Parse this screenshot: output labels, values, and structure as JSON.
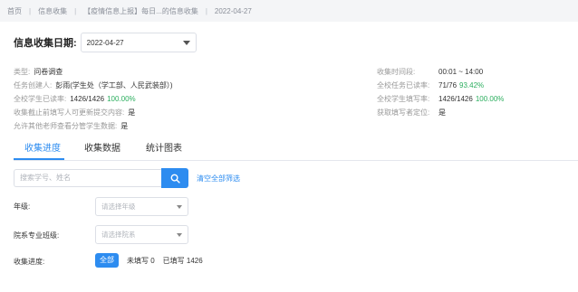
{
  "breadcrumb": {
    "items": [
      "首页",
      "信息收集",
      "【疫情信息上报】每日...的信息收集",
      "2022-04-27"
    ]
  },
  "date_picker": {
    "label": "信息收集日期:",
    "value": "2022-04-27"
  },
  "info_left": [
    {
      "key": "类型:",
      "value": "问卷调查"
    },
    {
      "key": "任务创建人:",
      "value": "彭雨(学生处（学工部、人民武装部）)"
    },
    {
      "key": "全校学生已读率:",
      "value": "1426/1426",
      "pct": "100.00%"
    },
    {
      "key": "收集截止前填写人可更新提交内容:",
      "value": "是"
    },
    {
      "key": "允许其他老师查看分管学生数据:",
      "value": "是"
    }
  ],
  "info_right": [
    {
      "key": "收集时间段:",
      "value": "00:01 ~ 14:00"
    },
    {
      "key": "全校任务已读率:",
      "value": "71/76",
      "pct": "93.42%"
    },
    {
      "key": "全校学生填写率:",
      "value": "1426/1426",
      "pct": "100.00%"
    },
    {
      "key": "获取填写者定位:",
      "value": "是"
    }
  ],
  "tabs": [
    "收集进度",
    "收集数据",
    "统计图表"
  ],
  "search": {
    "placeholder": "搜索学号、姓名",
    "clear_label": "清空全部筛选"
  },
  "filters": {
    "grade_label": "年级:",
    "grade_placeholder": "请选择年级",
    "department_label": "院系专业班级:",
    "department_placeholder": "请选择院系",
    "progress_label": "收集进度:",
    "progress_options": [
      "全部",
      "未填写 0",
      "已填写 1426"
    ]
  },
  "colors": {
    "accent": "#2d8cf0",
    "success": "#2bae5e"
  }
}
